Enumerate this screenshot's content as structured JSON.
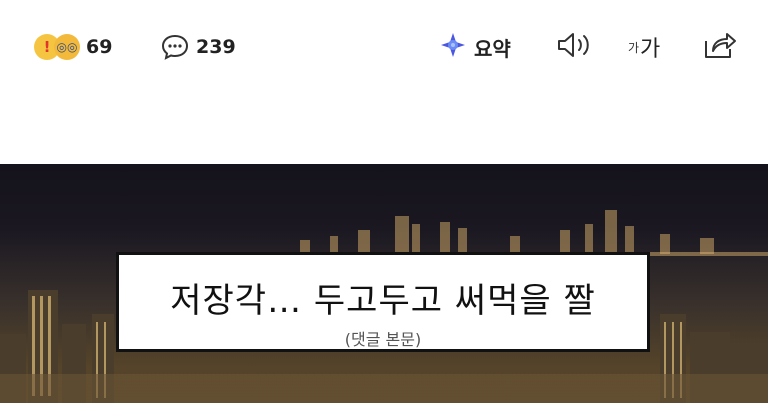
{
  "toolbar": {
    "reaction_count": "69",
    "comment_count": "239",
    "summary_label": "요약",
    "font_small": "가",
    "font_big": "가"
  },
  "icons": {
    "reactions": [
      "surprised-emoji",
      "thinking-emoji"
    ],
    "comment": "speech-bubble-icon",
    "summary": "ai-sparkle-icon",
    "speaker": "speaker-icon",
    "share": "share-icon"
  },
  "colors": {
    "summary_accent": "#4b57e0",
    "emoji_yellow": "#f5c542"
  },
  "banner": {
    "title": "저장각… 두고두고 써먹을 짤",
    "subtitle": "(댓글 본문)"
  }
}
